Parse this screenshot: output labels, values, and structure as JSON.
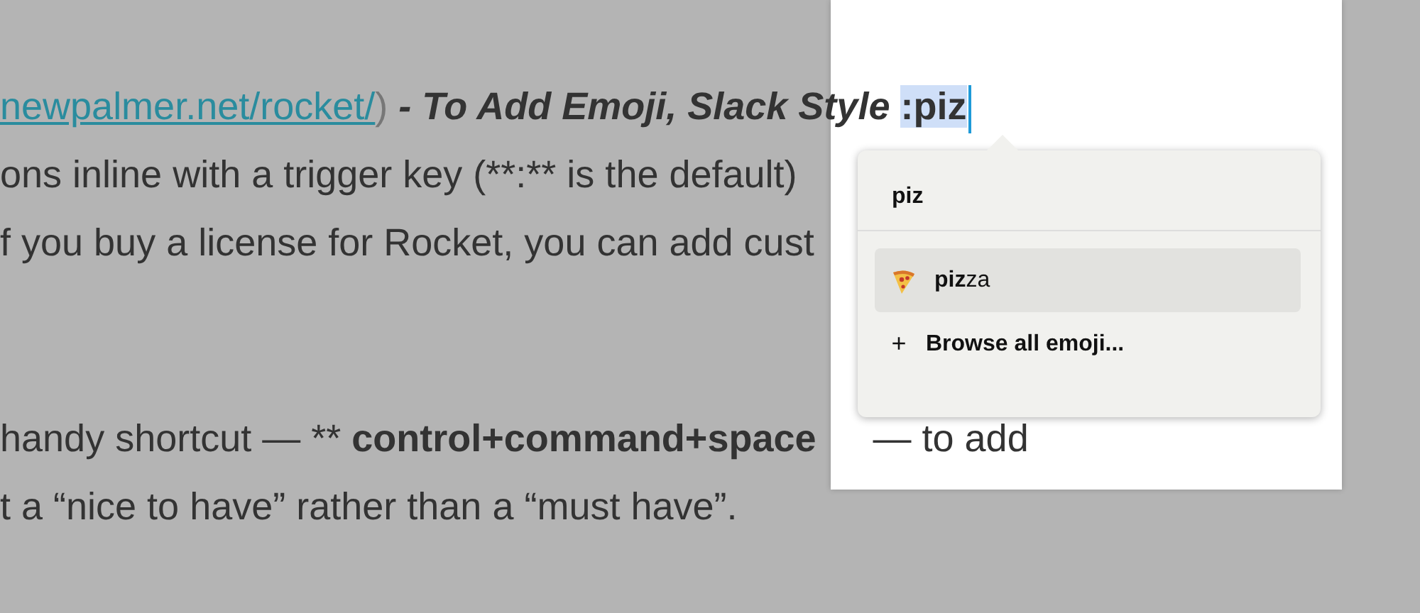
{
  "editor": {
    "paragraphs": [
      {
        "lines": [
          {
            "segments": [
              {
                "kind": "link",
                "text": "newpalmer.net/rocket/"
              },
              {
                "kind": "muted",
                "text": ")"
              },
              {
                "kind": "bold_italic",
                "text": " - To Add Emoji, Slack Style "
              },
              {
                "kind": "query",
                "text": ":piz"
              }
            ]
          },
          {
            "segments": [
              {
                "kind": "plain",
                "text": "ons inline with a trigger key (**:** is the default)"
              }
            ]
          },
          {
            "segments": [
              {
                "kind": "plain",
                "text": "f you buy a license for Rocket, you can add cust"
              }
            ]
          }
        ]
      },
      {
        "lines": [
          {
            "segments": [
              {
                "kind": "plain",
                "text": "handy shortcut — ** "
              },
              {
                "kind": "bold",
                "text": "control+command+space"
              },
              {
                "kind": "after_popup",
                "text": "— to add"
              }
            ]
          },
          {
            "segments": [
              {
                "kind": "plain",
                "text": "t a “nice to have” rather than a “must have”."
              }
            ]
          }
        ]
      }
    ]
  },
  "popup": {
    "query": "piz",
    "items": [
      {
        "kind": "emoji",
        "label": "**piz**za",
        "selected": true
      },
      {
        "kind": "browse",
        "icon": "+",
        "label": "Browse all emoji...",
        "selected": false
      }
    ]
  }
}
